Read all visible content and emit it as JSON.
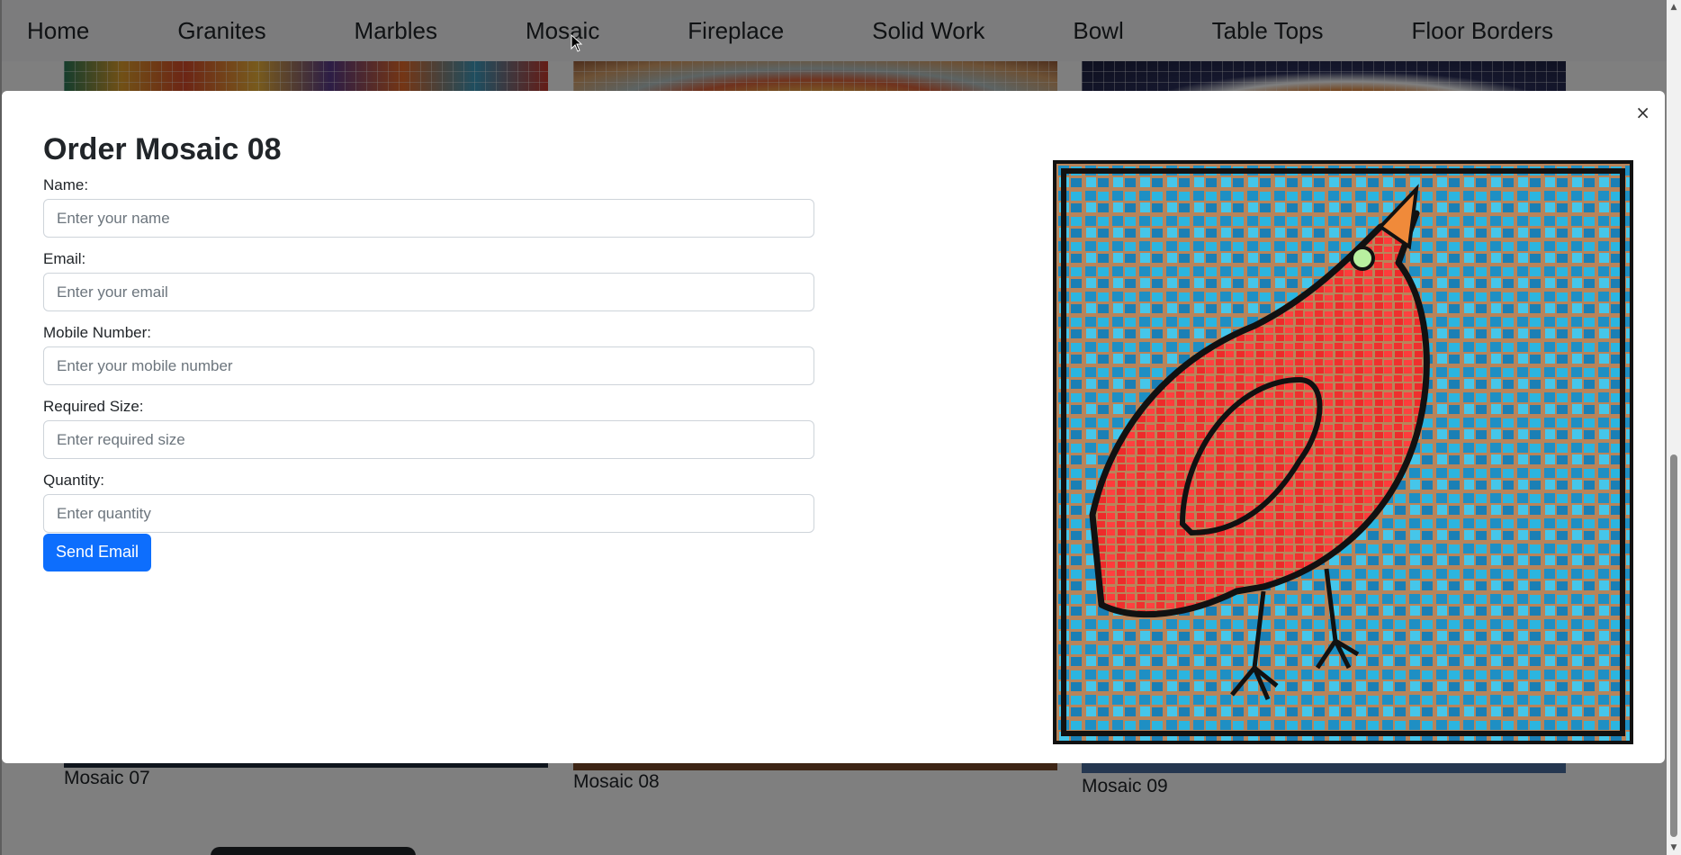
{
  "nav": {
    "items": [
      "Home",
      "Granites",
      "Marbles",
      "Mosaic",
      "Fireplace",
      "Solid Work",
      "Bowl",
      "Table Tops",
      "Floor Borders"
    ]
  },
  "gallery": {
    "captions": [
      "Mosaic 07",
      "Mosaic 08",
      "Mosaic 09"
    ]
  },
  "modal": {
    "title": "Order Mosaic 08",
    "close_symbol": "×",
    "fields": [
      {
        "label": "Name:",
        "placeholder": "Enter your name",
        "value": ""
      },
      {
        "label": "Email:",
        "placeholder": "Enter your email",
        "value": ""
      },
      {
        "label": "Mobile Number:",
        "placeholder": "Enter your mobile number",
        "value": ""
      },
      {
        "label": "Required Size:",
        "placeholder": "Enter required size",
        "value": ""
      },
      {
        "label": "Quantity:",
        "placeholder": "Enter quantity",
        "value": ""
      }
    ],
    "submit_label": "Send Email",
    "image_subject": "red bird mosaic on blue tiles"
  },
  "scrollbar": {
    "up_symbol": "▲",
    "down_symbol": "▼"
  },
  "colors": {
    "accent": "#0d6efd",
    "backdrop": "rgba(0,0,0,0.5)",
    "navbar_bg": "#f8f9fa"
  }
}
